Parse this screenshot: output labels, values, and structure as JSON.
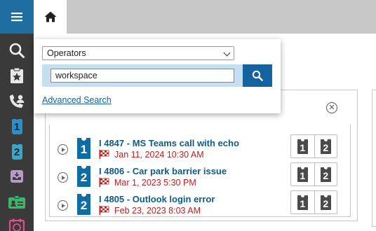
{
  "nav": {
    "menu_icon": "hamburger-icon",
    "items": [
      {
        "name": "search-icon"
      },
      {
        "name": "clipboard-star-icon"
      },
      {
        "name": "phone-user-icon"
      },
      {
        "name": "queue-1-icon",
        "label": "1"
      },
      {
        "name": "queue-2-icon",
        "label": "2"
      },
      {
        "name": "inbox-icon"
      },
      {
        "name": "id-card-icon"
      },
      {
        "name": "clock-icon"
      }
    ]
  },
  "topbar": {
    "home_icon": "home-icon"
  },
  "search_popup": {
    "scope_selected": "Operators",
    "query": "workspace",
    "search_button_icon": "search-icon",
    "advanced_link": "Advanced Search"
  },
  "tickets": [
    {
      "priority": "1",
      "title": "I 4847 - MS Teams call with echo",
      "date": "Jan 11, 2024 10:30 AM",
      "actions": [
        "1",
        "2"
      ]
    },
    {
      "priority": "2",
      "title": "I 4806 - Car park barrier issue",
      "date": "Mar 1, 2023 5:30 PM",
      "actions": [
        "1",
        "2"
      ]
    },
    {
      "priority": "2",
      "title": "I 4805 - Outlook login error",
      "date": "Feb 23, 2023 8:03 AM",
      "actions": [
        "1",
        "2"
      ]
    }
  ],
  "colors": {
    "brand": "#1f6ea2",
    "rail": "#3a3a3a",
    "ticket": "#0f6da6",
    "date_red": "#c02020",
    "link": "#1463a0"
  }
}
